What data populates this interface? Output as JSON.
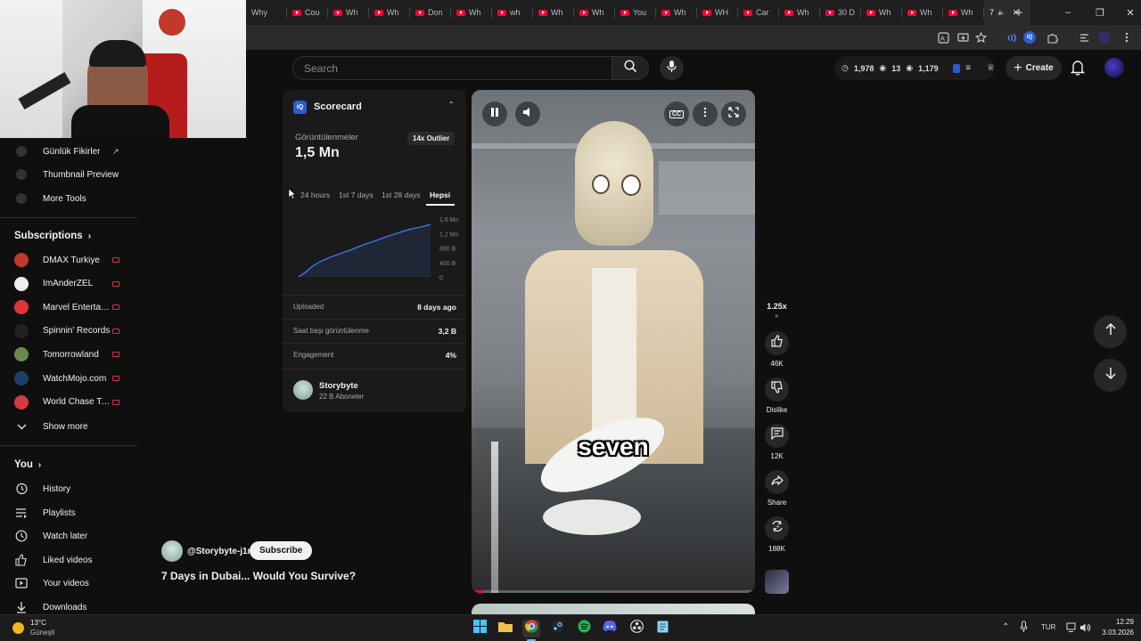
{
  "browser": {
    "tabs": [
      {
        "label": "Why"
      },
      {
        "label": "Cou"
      },
      {
        "label": "Wh"
      },
      {
        "label": "Wh"
      },
      {
        "label": "Don"
      },
      {
        "label": "Wh"
      },
      {
        "label": "wh"
      },
      {
        "label": "Wh"
      },
      {
        "label": "Wh"
      },
      {
        "label": "You"
      },
      {
        "label": "Wh"
      },
      {
        "label": "WH"
      },
      {
        "label": "Car"
      },
      {
        "label": "Wh"
      },
      {
        "label": "30 D"
      },
      {
        "label": "Wh"
      },
      {
        "label": "Wh"
      },
      {
        "label": "Wh"
      }
    ],
    "active_tab": {
      "label": "7"
    },
    "new_tab": "+",
    "minimize": "‒",
    "restore": "❐",
    "close": "✕"
  },
  "youtube": {
    "search_placeholder": "Search",
    "stats": {
      "a": "1,978",
      "b": "13",
      "c": "1,179"
    },
    "create_label": "Create"
  },
  "sidebar": {
    "top_items": [
      {
        "label": "Günlük Fikirler"
      },
      {
        "label": "Thumbnail Preview"
      },
      {
        "label": "More Tools"
      }
    ],
    "subscriptions_heading": "Subscriptions",
    "subscriptions": [
      {
        "label": "DMAX Turkiye",
        "color": "#c0392b"
      },
      {
        "label": "ImAnderZEL",
        "color": "#eeeeee"
      },
      {
        "label": "Marvel Entertain...",
        "color": "#e23636"
      },
      {
        "label": "Spinnin' Records",
        "color": "#222222"
      },
      {
        "label": "Tomorrowland",
        "color": "#6a8a4a"
      },
      {
        "label": "WatchMojo.com",
        "color": "#1b3f6b"
      },
      {
        "label": "World Chase Tag",
        "color": "#d63b3b"
      }
    ],
    "show_more": "Show more",
    "you_heading": "You",
    "you_items": [
      {
        "label": "History"
      },
      {
        "label": "Playlists"
      },
      {
        "label": "Watch later"
      },
      {
        "label": "Liked videos"
      },
      {
        "label": "Your videos"
      },
      {
        "label": "Downloads"
      }
    ]
  },
  "scorecard": {
    "title": "Scorecard",
    "views_label": "Görüntülenmeler",
    "views_value": "1,5 Mn",
    "outlier_badge": "14x Outlier",
    "ranges": [
      "24 hours",
      "1st 7 days",
      "1st 28 days",
      "Hepsi"
    ],
    "selected_range": "Hepsi",
    "uploaded_label": "Uploaded",
    "uploaded_value": "8 days ago",
    "hourly_label": "Saat başı görüntülenme",
    "hourly_value": "3,2 B",
    "engagement_label": "Engagement",
    "engagement_value": "4%",
    "channel_name": "Storybyte",
    "channel_subs": "22 B Aboneler"
  },
  "chart_data": {
    "type": "line",
    "title": "",
    "xlabel": "",
    "ylabel": "",
    "y_ticks": [
      "1,6 Mn",
      "1,2 Mn",
      "800 B",
      "400 B",
      "0"
    ],
    "ylim": [
      0,
      1600000
    ],
    "x": [
      0,
      1,
      2,
      3,
      4,
      5,
      6,
      7,
      8,
      9,
      10,
      11,
      12,
      13,
      14,
      15,
      16,
      17,
      18,
      19,
      20
    ],
    "values": [
      0,
      120000,
      280000,
      400000,
      480000,
      560000,
      620000,
      690000,
      750000,
      830000,
      900000,
      960000,
      1020000,
      1090000,
      1150000,
      1210000,
      1270000,
      1320000,
      1360000,
      1400000,
      1450000
    ],
    "grid": false,
    "color": "#3d6fd8"
  },
  "video": {
    "caption": "seven",
    "cc_label": "CC",
    "channel_handle": "@Storybyte-j1n",
    "subscribe_label": "Subscribe",
    "title": "7 Days in Dubai... Would You Survive?",
    "speed": "1.25x"
  },
  "actions": {
    "likes": "46K",
    "dislike_label": "Dislike",
    "comments": "12K",
    "share_label": "Share",
    "remixes": "188K"
  },
  "taskbar": {
    "weather_temp": "13°C",
    "weather_desc": "Güneşli",
    "lang": "TUR",
    "time": "12:29",
    "date": "3.03.2026"
  }
}
